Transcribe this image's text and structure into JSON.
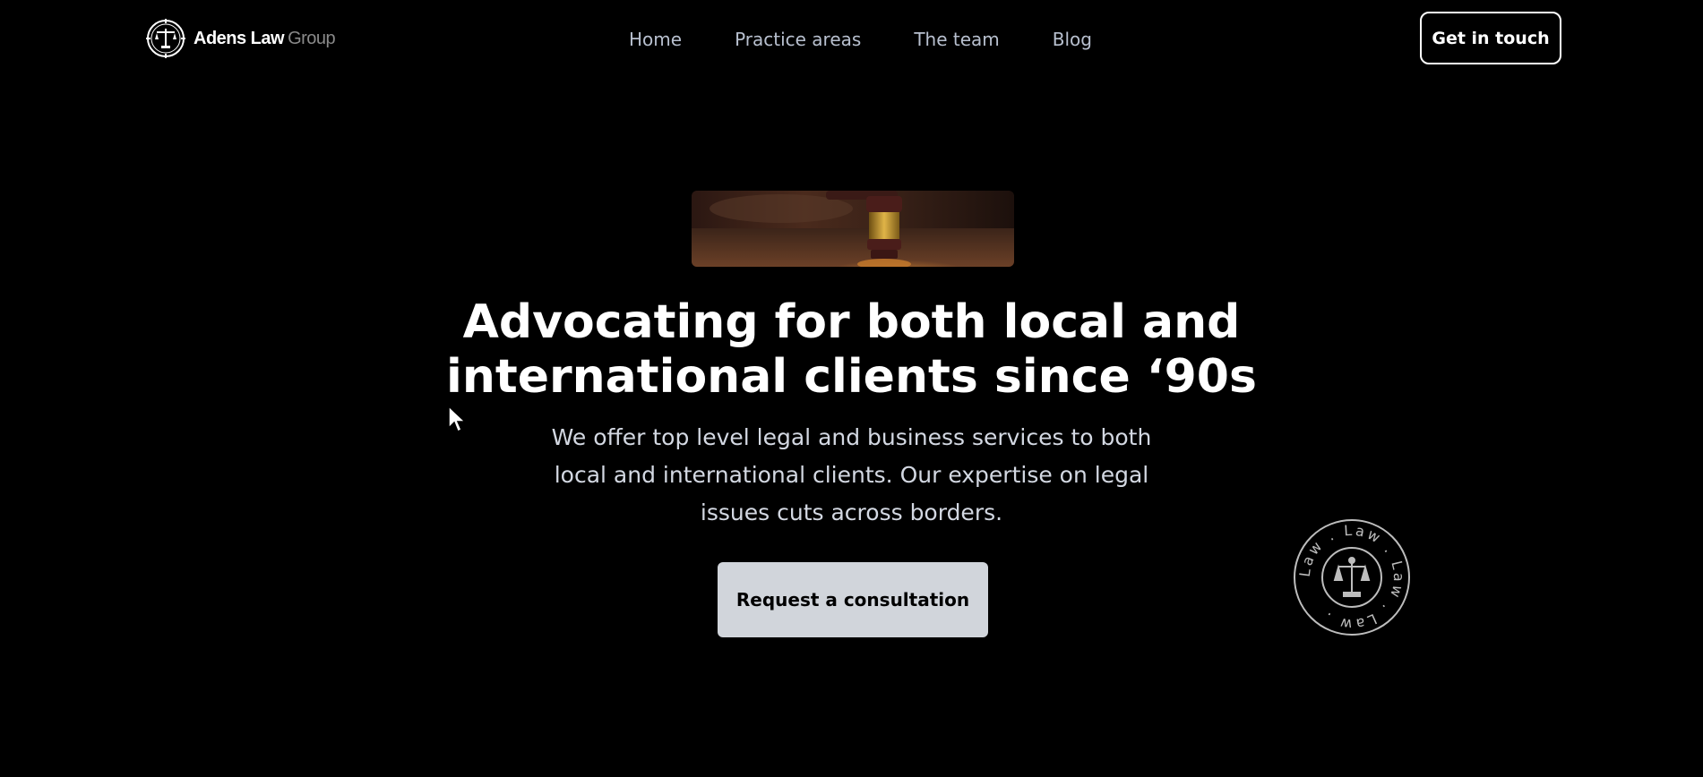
{
  "header": {
    "logo": {
      "name": "Adens Law",
      "suffix": "Group"
    },
    "nav": [
      "Home",
      "Practice areas",
      "The team",
      "Blog"
    ],
    "cta_label": "Get in touch"
  },
  "hero": {
    "image_alt_icon": "gavel-image",
    "title_line1": "Advocating for both local and",
    "title_line2": "international clients since ‘90s",
    "subtitle": "We offer top level legal and business services to both local and international clients. Our expertise on legal issues cuts across borders.",
    "cta_label": "Request a consultation"
  },
  "badge": {
    "ring_text": "Law . Law . Law . Law .",
    "icon": "scales-icon"
  },
  "colors": {
    "background": "#000000",
    "nav_text": "#b8c0cf",
    "button_fill": "#d1d5db",
    "subtitle_text": "#d3d8e2"
  }
}
